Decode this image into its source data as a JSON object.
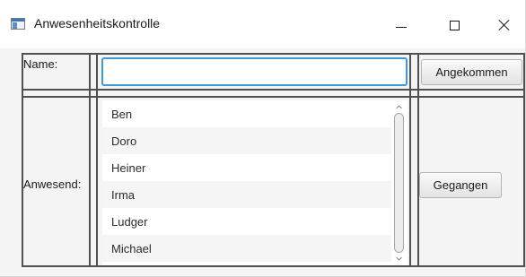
{
  "window": {
    "title": "Anwesenheitskontrolle"
  },
  "form": {
    "name_label": "Name:",
    "name_value": "",
    "arrived_button": "Angekommen",
    "present_label": "Anwesend:",
    "left_button": "Gegangen"
  },
  "list": {
    "items": [
      "Ben",
      "Doro",
      "Heiner",
      "Irma",
      "Ludger",
      "Michael"
    ]
  },
  "colors": {
    "focus_border": "#3a9bd5",
    "grid_line": "#505050",
    "content_bg": "#f4f4f4"
  },
  "icons": {
    "app": "app-window-icon",
    "minimize": "minimize-icon",
    "maximize": "maximize-icon",
    "close": "close-icon",
    "scroll_up": "chevron-up-icon",
    "scroll_down": "chevron-down-icon"
  }
}
